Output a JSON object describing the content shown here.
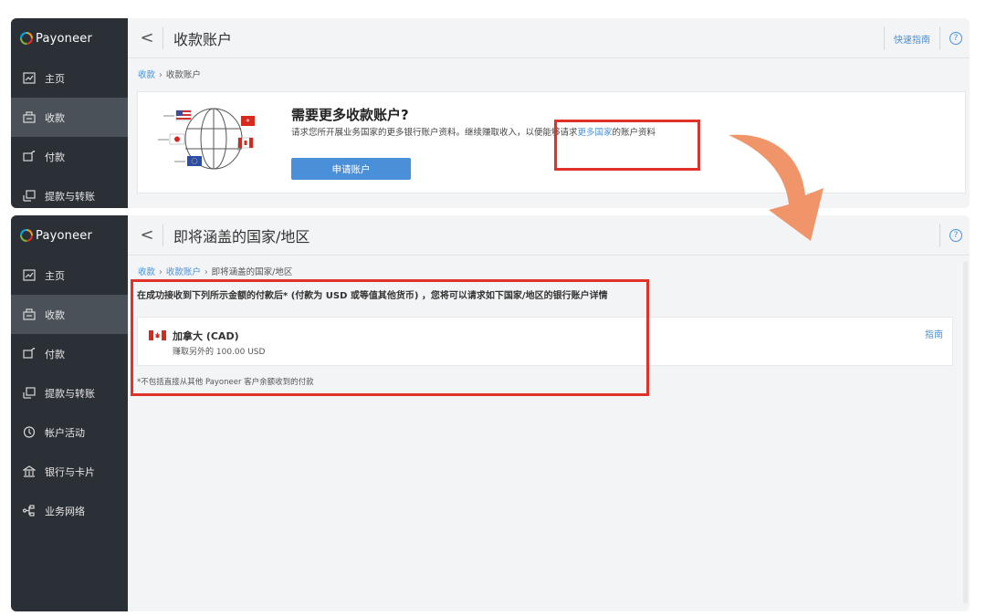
{
  "brand": {
    "name": "Payoneer"
  },
  "top": {
    "nav": [
      {
        "label": "主页",
        "icon": "chart-icon",
        "active": false
      },
      {
        "label": "收款",
        "icon": "receive-icon",
        "active": true
      },
      {
        "label": "付款",
        "icon": "pay-icon",
        "active": false
      },
      {
        "label": "提款与转账",
        "icon": "withdraw-icon",
        "active": false
      }
    ],
    "header": {
      "back": "<",
      "title": "收款账户",
      "quick_guide": "快速指南",
      "help": "?"
    },
    "breadcrumb": {
      "home": "收款",
      "current": "收款账户"
    },
    "promo": {
      "title": "需要更多收款账户?",
      "desc_prefix": "请求您所开展业务国家的更多银行账户资料。继续赚取收入，以便能够请求",
      "desc_link": "更多国家",
      "desc_suffix": "的账户资料",
      "button": "申请账户"
    }
  },
  "bottom": {
    "nav": [
      {
        "label": "主页"
      },
      {
        "label": "收款"
      },
      {
        "label": "付款"
      },
      {
        "label": "提款与转账"
      },
      {
        "label": "帐户活动"
      },
      {
        "label": "银行与卡片"
      },
      {
        "label": "业务网络"
      }
    ],
    "header": {
      "back": "<",
      "title": "即将涵盖的国家/地区",
      "help": "?"
    },
    "breadcrumb": {
      "home": "收款",
      "mid": "收款账户",
      "current": "即将涵盖的国家/地区"
    },
    "notice": "在成功接收到下列所示金额的付款后* (付款为 USD 或等值其他货币) ，您将可以请求如下国家/地区的银行账户详情",
    "card": {
      "country": "加拿大 (CAD)",
      "earn": "赚取另外的 100.00 USD",
      "guide": "指南"
    },
    "footnote": "*不包括直接从其他 Payoneer 客户余额收到的付款"
  },
  "colors": {
    "accent": "#4a90d9",
    "sidebar": "#2b2f36",
    "highlight": "#e0312b",
    "arrow": "#f0956a"
  }
}
